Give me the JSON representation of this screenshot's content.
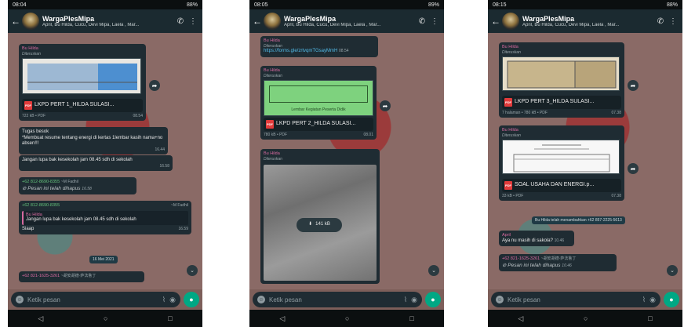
{
  "phones": [
    {
      "status": {
        "time": "08:04",
        "right": "88%"
      },
      "header": {
        "title": "WargaPlesMipa",
        "subtitle": "April, Bu Hilda, Cucu, Devi Mipa, Laela , Mar..."
      },
      "messages": {
        "m1_sender": "Bu Hilda",
        "m1_fwd": "Diteruskan",
        "m1_doc": "LKPD PERT 1_HILDA SULASI...",
        "m1_size": "722 kB • PDF",
        "m1_time": "08.54",
        "m2_text": "Tugas besok \n*Membuat resume tentang energi di kertas 1lembar kasih nama+no absen!!!",
        "m2_time": "16.44",
        "m3_text": "Jangan lupa bak kesekolah jam 08.45 sdh di sekolah",
        "m3_time": "16.58",
        "m4_sender": "+62 812-8690-8355",
        "m4_alias": "~M Fadhil",
        "m4_text": "Pesan ini telah dihapus",
        "m4_time": "16.58",
        "m5_sender": "+62 812-8690-8355",
        "m5_alias": "~M Fadhil",
        "m5_quote_sender": "Bu Hilda",
        "m5_quote": "Jangan lupa bak kesekolah jam 08.45 sdh di sekolah",
        "m5_text": "Siaap",
        "m5_time": "16.59",
        "date": "16 Mei 2021",
        "m6_sender": "+62 821-1625-3261",
        "m6_alias": "~胡安胡德·萨法鲁丁"
      },
      "input_placeholder": "Ketik pesan"
    },
    {
      "status": {
        "time": "08:05",
        "right": "89%"
      },
      "header": {
        "title": "WargaPlesMipa",
        "subtitle": "April, Bu Hilda, Cucu, Devi Mipa, Laela , Mar..."
      },
      "messages": {
        "m1_sender": "Bu Hilda",
        "m1_fwd": "Diteruskan",
        "m1_link": "https://forms.gle/zrtvqmTGsayMmH",
        "m1_time": "08.54",
        "m2_sender": "Bu Hilda",
        "m2_fwd": "Diteruskan",
        "m2_thumb": "Lembar Kegiatan Peserta Didik",
        "m2_doc": "LKPD PERT 2_HILDA SULASI...",
        "m2_size": "780 kB • PDF",
        "m2_time": "08.01",
        "m3_sender": "Bu Hilda",
        "m3_fwd": "Diteruskan",
        "m3_dl": "141 kB"
      },
      "input_placeholder": "Ketik pesan"
    },
    {
      "status": {
        "time": "08:15",
        "right": "88%"
      },
      "header": {
        "title": "WargaPlesMipa",
        "subtitle": "April, Bu Hilda, Cucu, Devi Mipa, Laela , Mar..."
      },
      "messages": {
        "m1_sender": "Bu Hilda",
        "m1_fwd": "Diteruskan",
        "m1_doc": "LKPD PERT 3_HILDA SULASI...",
        "m1_size": "7 halaman • 780 kB • PDF",
        "m1_time": "07.38",
        "m2_sender": "Bu Hilda",
        "m2_fwd": "Diteruskan",
        "m2_doc": "SOAL USAHA DAN ENERGI.p...",
        "m2_size": "33 kB • PDF",
        "m2_time": "07.38",
        "system": "Bu Hilda telah menambahkan +62 857-2225-5613",
        "m3_sender": "April",
        "m3_text": "Aya nu masih di sakola?",
        "m3_time": "10.46",
        "m4_sender": "+62 821-1625-3261",
        "m4_alias": "~胡安胡德·萨法鲁丁",
        "m4_text": "Pesan ini telah dihapus",
        "m4_time": "10.46"
      },
      "input_placeholder": "Ketik pesan"
    }
  ]
}
